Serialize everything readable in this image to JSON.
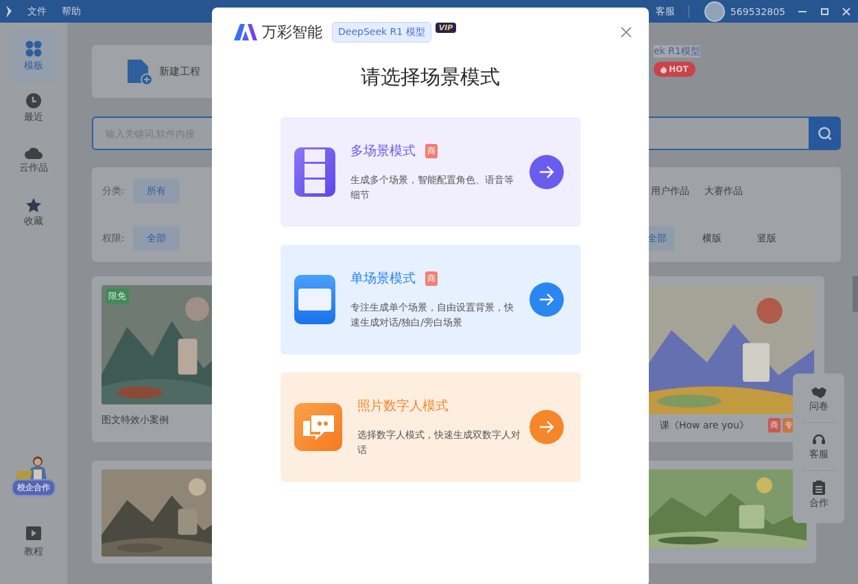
{
  "title_bar": {
    "menus": [
      "文件",
      "帮助"
    ],
    "support": "客服",
    "user_id": "569532805"
  },
  "sidebar": {
    "items": [
      {
        "label": "模板",
        "selected": true
      },
      {
        "label": "最近",
        "selected": false
      },
      {
        "label": "云作品",
        "selected": false
      },
      {
        "label": "收藏",
        "selected": false
      }
    ],
    "promo": "校企合作",
    "tutorial": "教程"
  },
  "new_project": "新建工程",
  "model_card": {
    "label": "ek R1模型",
    "badge": "HOT"
  },
  "search": {
    "placeholder": "输入关键词,软件内搜"
  },
  "filters": [
    {
      "label": "分类:",
      "left_options": [
        {
          "text": "所有",
          "selected": true
        }
      ],
      "right_options": [
        {
          "text": "用户作品",
          "selected": false
        },
        {
          "text": "大赛作品",
          "selected": false
        }
      ]
    },
    {
      "label": "权限:",
      "left_options": [
        {
          "text": "全部",
          "selected": true
        }
      ],
      "right_options": [
        {
          "text": "全部",
          "selected": true
        },
        {
          "text": "横版",
          "selected": false
        },
        {
          "text": "竖版",
          "selected": false
        }
      ]
    }
  ],
  "templates": [
    {
      "caption": "图文特效小案例",
      "badge": "限免"
    },
    {
      "caption": "课《How are you》",
      "tags": [
        "商",
        "专"
      ]
    }
  ],
  "side_panel": [
    "问卷",
    "客服",
    "合作"
  ],
  "dialog": {
    "brand": "万彩智能",
    "model_tag": "DeepSeek R1 模型",
    "vip": "VIP",
    "heading": "请选择场景模式",
    "modes": [
      {
        "kind": "film",
        "title": "多场景模式",
        "badge": "商",
        "description": "生成多个场景，智能配置角色、语音等细节",
        "color": "#6b5cf0"
      },
      {
        "kind": "screen",
        "title": "单场景模式",
        "badge": "商",
        "description": "专注生成单个场景，自由设置背景，快速生成对话/独白/旁白场景",
        "color": "#2a86f0"
      },
      {
        "kind": "chat",
        "title": "照片数字人模式",
        "description": "选择数字人模式，快速生成双数字人对话",
        "color": "#f5862a"
      }
    ]
  }
}
